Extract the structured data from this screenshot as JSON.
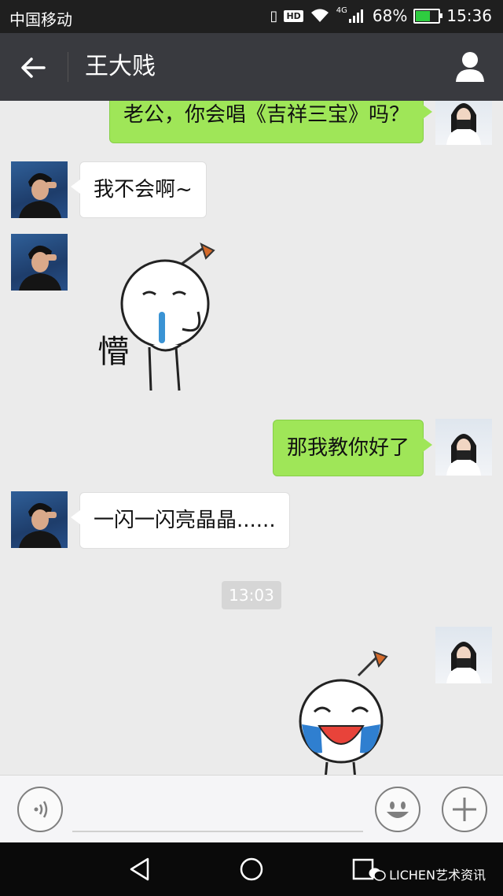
{
  "status_bar": {
    "carrier": "中国移动",
    "battery": "68%",
    "battery_level": 0.68,
    "time": "15:36",
    "hd": "HD",
    "network": "4G"
  },
  "header": {
    "title": "王大贱"
  },
  "messages": [
    {
      "from": "me",
      "text": "老公，你会唱《吉祥三宝》吗？"
    },
    {
      "from": "him",
      "text": "我不会啊~"
    },
    {
      "from": "him",
      "sticker_text": "懵"
    },
    {
      "from": "me",
      "text": "那我教你好了"
    },
    {
      "from": "him",
      "text": "一闪一闪亮晶晶......"
    },
    {
      "from": "me",
      "sticker": "laughing-crying-sticker"
    }
  ],
  "timestamp": "13:03",
  "watermark": "LICHEN艺术资讯",
  "colors": {
    "me_bubble": "#9fe658",
    "them_bubble": "#ffffff",
    "header_bg": "#393a3f",
    "chat_bg": "#ebebeb"
  }
}
